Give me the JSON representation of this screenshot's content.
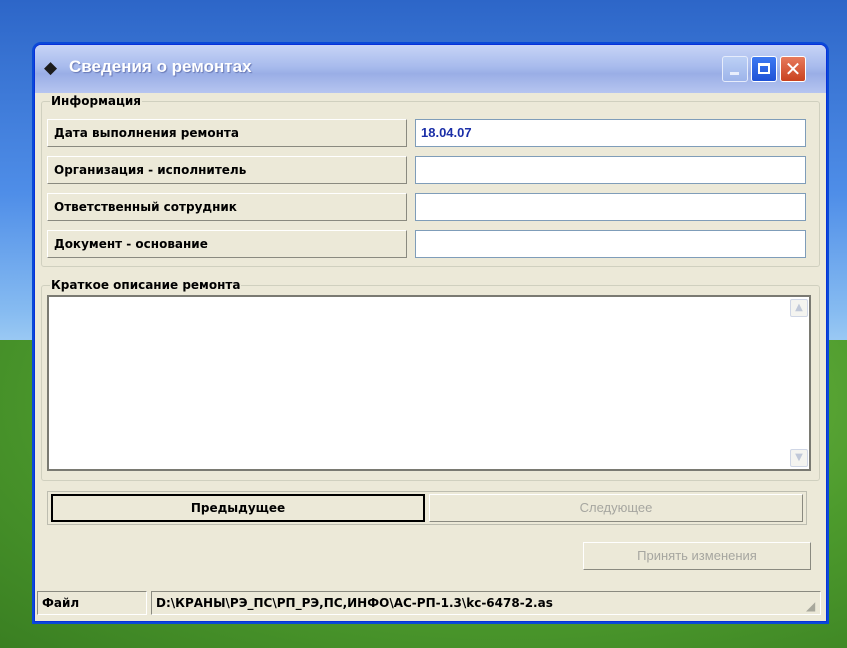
{
  "window": {
    "title": "Сведения о ремонтах",
    "title_icon": "chip-icon",
    "colors": {
      "titlebar": "#9aaee6",
      "close": "#c9421f",
      "value_text": "#1b2fa8",
      "disabled_text": "#a6a6a0"
    }
  },
  "info": {
    "legend": "Информация",
    "fields": [
      {
        "label": "Дата выполнения ремонта",
        "value": "18.04.07"
      },
      {
        "label": "Организация - исполнитель",
        "value": ""
      },
      {
        "label": "Ответственный сотрудник",
        "value": ""
      },
      {
        "label": "Документ - основание",
        "value": ""
      }
    ]
  },
  "description": {
    "legend": "Краткое описание ремонта",
    "value": ""
  },
  "nav": {
    "prev_label": "Предыдущее",
    "next_label": "Следующее",
    "accept_label": "Принять изменения"
  },
  "status": {
    "label": "Файл",
    "path": "D:\\КРАНЫ\\РЭ_ПС\\РП_РЭ,ПС,ИНФО\\АС-РП-1.3\\kc-6478-2.as"
  }
}
